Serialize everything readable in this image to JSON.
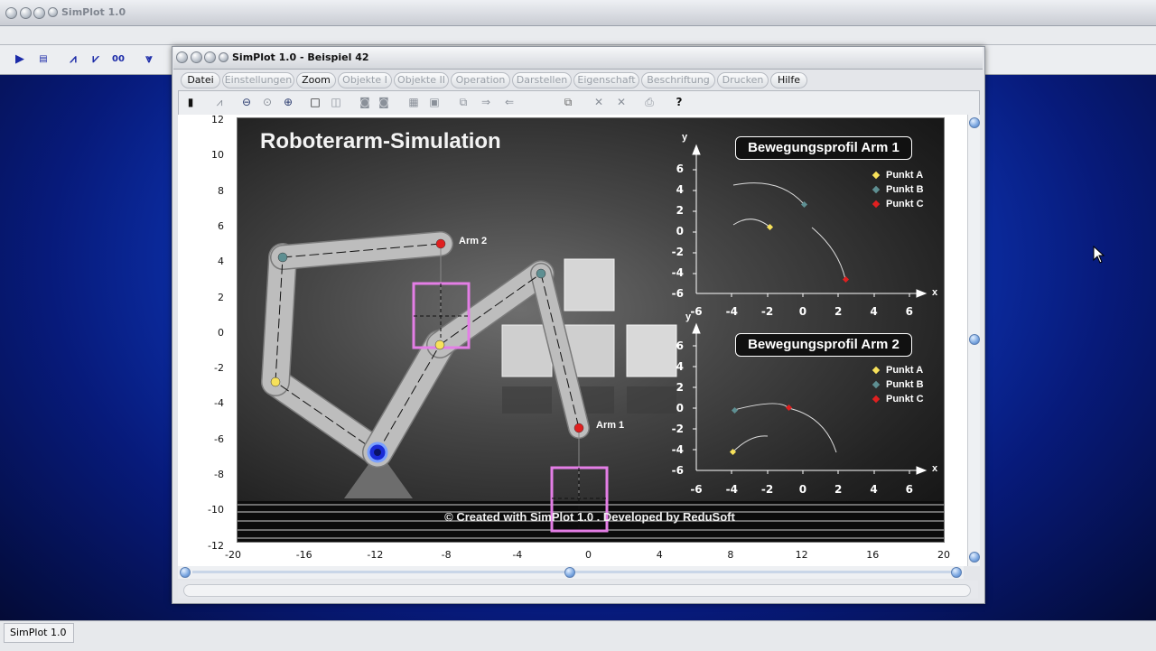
{
  "outer_window": {
    "title": "SimPlot 1.0"
  },
  "status_bar": {
    "text": "SimPlot 1.0"
  },
  "inner_window": {
    "title": "SimPlot 1.0 - Beispiel 42"
  },
  "menu": [
    {
      "label": "Datei",
      "enabled": true
    },
    {
      "label": "Einstellungen",
      "enabled": false
    },
    {
      "label": "Zoom",
      "enabled": true
    },
    {
      "label": "Objekte I",
      "enabled": false
    },
    {
      "label": "Objekte II",
      "enabled": false
    },
    {
      "label": "Operation",
      "enabled": false
    },
    {
      "label": "Darstellen",
      "enabled": false
    },
    {
      "label": "Eigenschaft",
      "enabled": false
    },
    {
      "label": "Beschriftung",
      "enabled": false
    },
    {
      "label": "Drucken",
      "enabled": false
    },
    {
      "label": "Hilfe",
      "enabled": true
    }
  ],
  "plot": {
    "y_ticks": [
      "12",
      "10",
      "8",
      "6",
      "4",
      "2",
      "0",
      "-2",
      "-4",
      "-6",
      "-8",
      "-10",
      "-12"
    ],
    "x_ticks": [
      "-20",
      "-16",
      "-12",
      "-8",
      "-4",
      "0",
      "4",
      "8",
      "12",
      "16",
      "20"
    ]
  },
  "scene": {
    "title": "Roboterarm-Simulation",
    "copyright": "© Created with SimPlot 1.0 . Developed by ReduSoft",
    "arm1_label": "Arm 1",
    "arm2_label": "Arm 2"
  },
  "profile1": {
    "title": "Bewegungsprofil Arm 1",
    "y_axis_label": "y",
    "x_axis_label": "x",
    "y_ticks": [
      "6",
      "4",
      "2",
      "0",
      "-2",
      "-4",
      "-6"
    ],
    "x_ticks": [
      "-6",
      "-4",
      "-2",
      "0",
      "2",
      "4",
      "6"
    ],
    "legend": [
      {
        "label": "Punkt A",
        "color": "#f7e15a"
      },
      {
        "label": "Punkt B",
        "color": "#5e8f92"
      },
      {
        "label": "Punkt C",
        "color": "#e02020"
      }
    ]
  },
  "profile2": {
    "title": "Bewegungsprofil Arm 2",
    "y_axis_label": "y",
    "x_axis_label": "x",
    "y_ticks": [
      "6",
      "4",
      "2",
      "0",
      "-2",
      "-4",
      "-6"
    ],
    "x_ticks": [
      "-6",
      "-4",
      "-2",
      "0",
      "2",
      "4",
      "6"
    ],
    "legend": [
      {
        "label": "Punkt A",
        "color": "#f7e15a"
      },
      {
        "label": "Punkt B",
        "color": "#5e8f92"
      },
      {
        "label": "Punkt C",
        "color": "#e02020"
      }
    ]
  },
  "colors": {
    "highlight_box": "#e47ee6",
    "joint_base": "#1a2bd6"
  }
}
